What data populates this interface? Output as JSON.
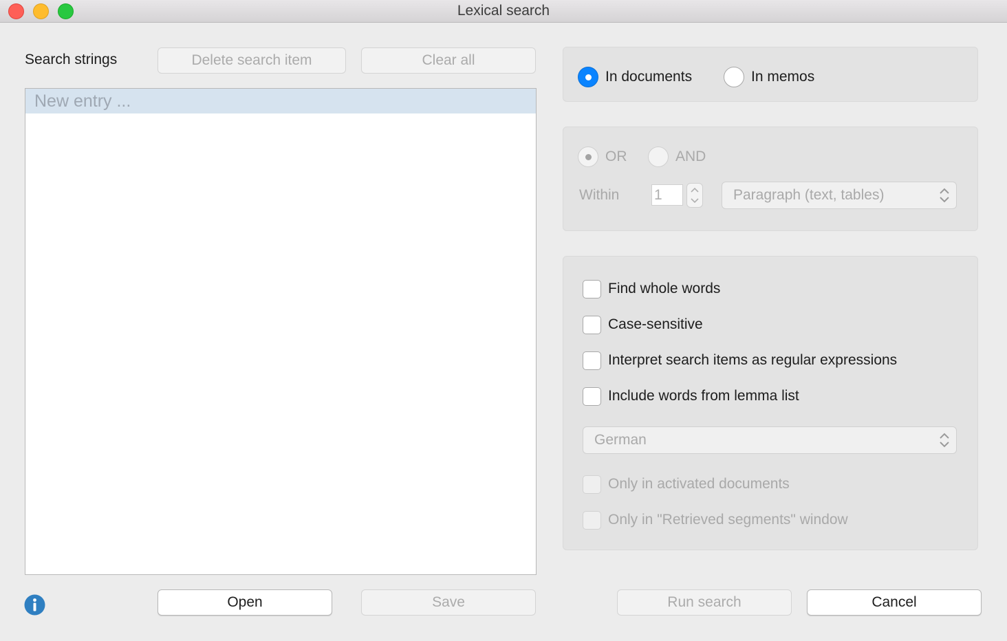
{
  "window": {
    "title": "Lexical search"
  },
  "search_panel": {
    "label": "Search strings",
    "delete_button": "Delete search item",
    "clear_button": "Clear all",
    "new_entry_placeholder": "New entry ..."
  },
  "scope": {
    "in_documents": "In documents",
    "in_memos": "In memos",
    "selected": "in_documents"
  },
  "combine": {
    "or_label": "OR",
    "and_label": "AND",
    "within_label": "Within",
    "within_value": "1",
    "unit_select": "Paragraph (text, tables)"
  },
  "options": {
    "find_whole_words": "Find whole words",
    "case_sensitive": "Case-sensitive",
    "regex": "Interpret search items as regular expressions",
    "lemma": "Include words from lemma list",
    "language_select": "German",
    "only_activated": "Only in activated documents",
    "only_retrieved": "Only in \"Retrieved segments\" window"
  },
  "footer": {
    "open": "Open",
    "save": "Save",
    "run_search": "Run search",
    "cancel": "Cancel"
  },
  "icons": {
    "info": "info-icon",
    "chevrons": "updown-chevron-icon"
  },
  "colors": {
    "accent": "#0a84ff",
    "selection_row": "#d6e3ef",
    "window_bg": "#ececec",
    "info_icon": "#2f7fc1"
  }
}
